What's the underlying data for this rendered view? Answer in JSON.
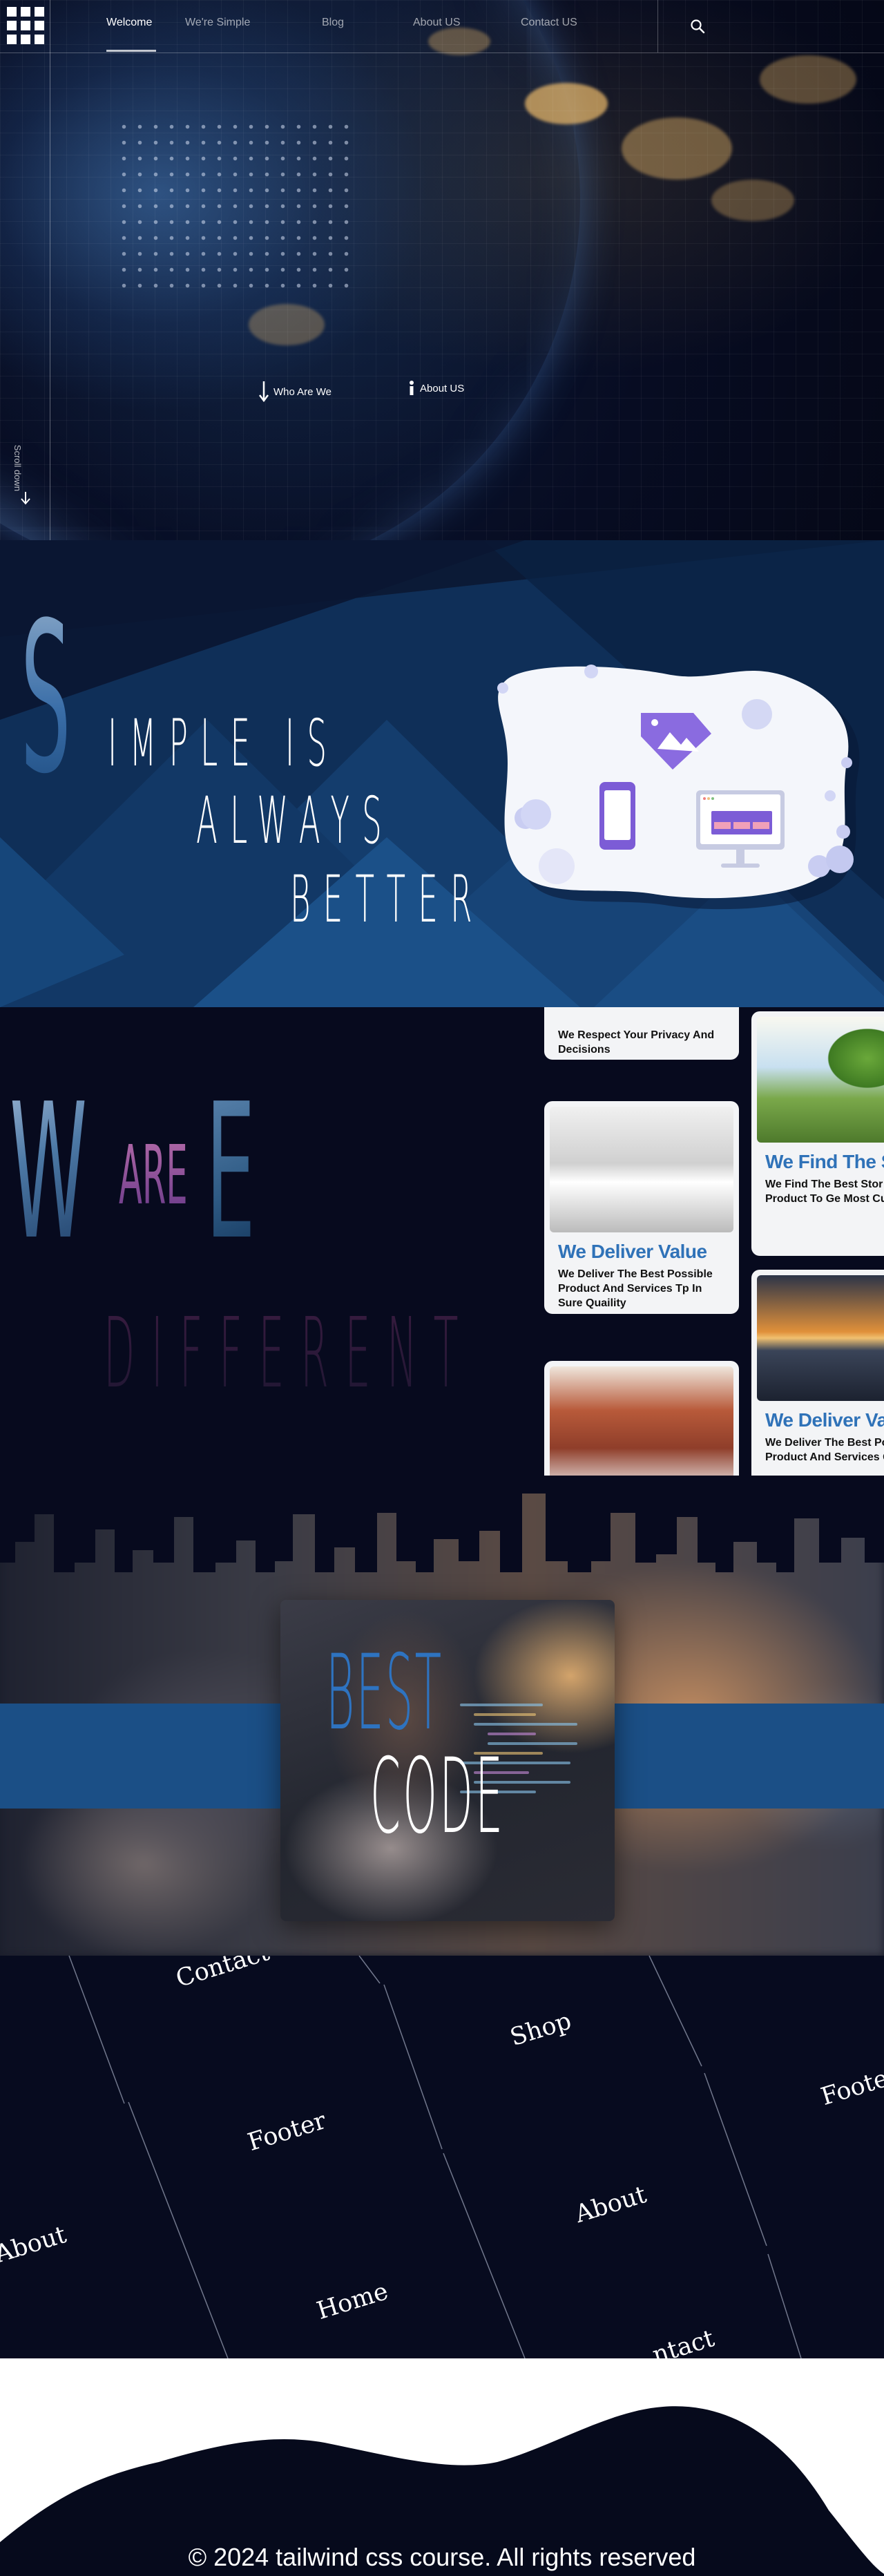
{
  "nav": {
    "links": [
      "Welcome",
      "We're Simple",
      "Blog",
      "About US",
      "Contact US"
    ],
    "active": "Welcome",
    "icons": {
      "logo": "grid-logo-icon",
      "search": "search-icon"
    }
  },
  "hero": {
    "cta_primary": "Who Are We",
    "cta_secondary": "About US",
    "scroll_label": "Scroll down"
  },
  "simple": {
    "initial": "S",
    "line1": "IMPLE IS",
    "line2": "ALWAYS",
    "line3": "BETTER"
  },
  "different": {
    "letter_w": "W",
    "word_are": "ARE",
    "letter_e": "E",
    "word_different": "DIFFERENT",
    "cards": [
      {
        "title": "",
        "description": "We Respect Your Privacy And Decisions"
      },
      {
        "title": "We Deliver Value",
        "description": "We Deliver The Best Possible Product And Services Tp In Sure Quaility"
      },
      {
        "title": "We Find The St",
        "description": "We Find The Best Stor For Your Product To Ge Most Customers"
      },
      {
        "title": "We Deliver Val",
        "description": "We Deliver The Best Po Product And Services Quaility"
      }
    ]
  },
  "code_section": {
    "line1": "BEST",
    "line2": "CODE"
  },
  "tiles": {
    "labels": [
      "Contact",
      "Shop",
      "Footer",
      "Footer",
      "About",
      "About",
      "Home",
      "ntact"
    ]
  },
  "footer": {
    "copyright": "© 2024 tailwind css course. All rights reserved"
  },
  "colors": {
    "background": "#060a1c",
    "accent_blue": "#2f72b8",
    "band_blue": "#1b4f86",
    "purple": "#7c5cd6"
  }
}
